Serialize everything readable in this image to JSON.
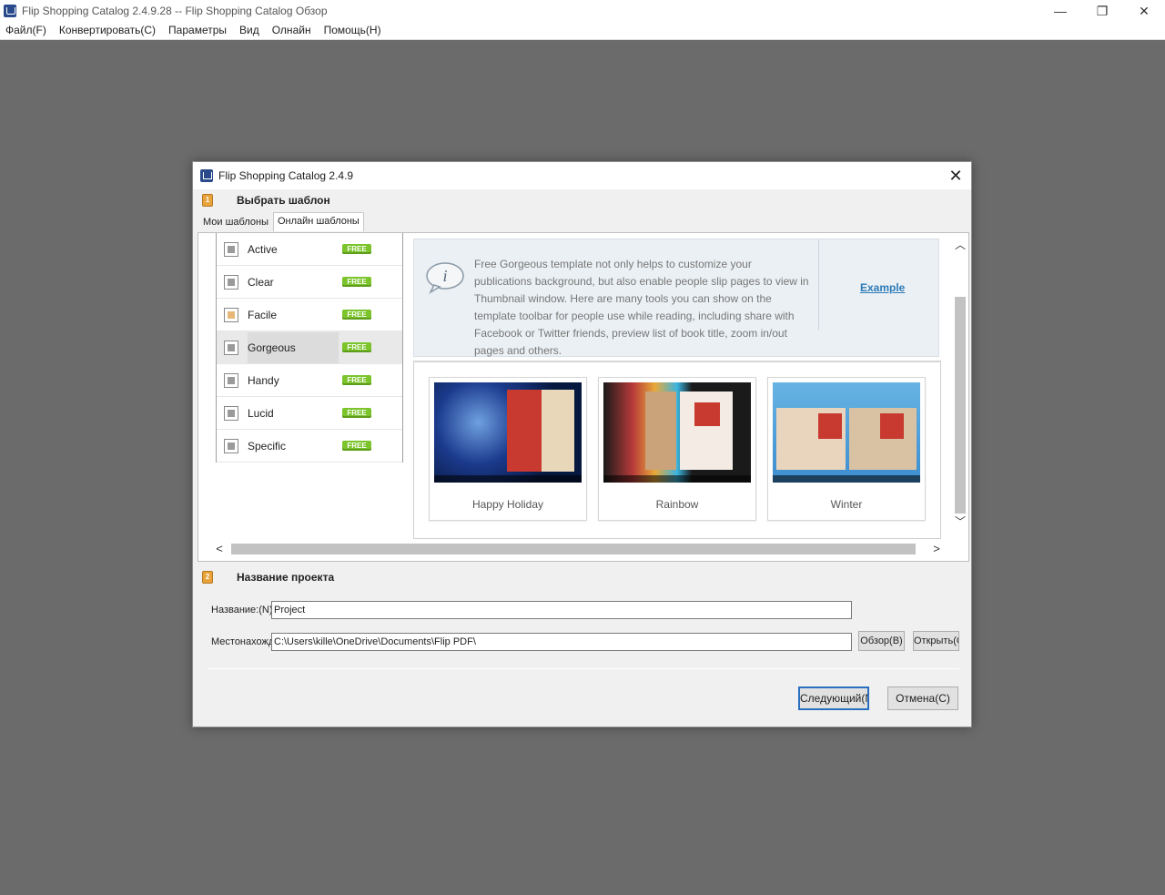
{
  "window": {
    "title": "Flip Shopping Catalog 2.4.9.28 -- Flip Shopping Catalog Обзор",
    "controls": {
      "minimize": "—",
      "maximize": "❐",
      "close": "✕"
    }
  },
  "menu": [
    "Файл(F)",
    "Конвертировать(C)",
    "Параметры",
    "Вид",
    "Олнайн",
    "Помощь(H)"
  ],
  "dialog": {
    "title": "Flip Shopping Catalog 2.4.9",
    "close": "✕",
    "step1": {
      "badge": "1",
      "label": "Выбрать шаблон"
    },
    "tabs": [
      {
        "label": "Мои шаблоны",
        "active": false
      },
      {
        "label": "Онлайн шаблоны",
        "active": true
      }
    ],
    "templates": [
      {
        "name": "Active",
        "badge": "FREE",
        "icon": "template-icon"
      },
      {
        "name": "Clear",
        "badge": "FREE",
        "icon": "template-icon"
      },
      {
        "name": "Facile",
        "badge": "FREE",
        "icon": "template-gold-icon"
      },
      {
        "name": "Gorgeous",
        "badge": "FREE",
        "icon": "template-icon",
        "selected": true
      },
      {
        "name": "Handy",
        "badge": "FREE",
        "icon": "template-icon"
      },
      {
        "name": "Lucid",
        "badge": "FREE",
        "icon": "template-icon"
      },
      {
        "name": "Specific",
        "badge": "FREE",
        "icon": "template-icon"
      }
    ],
    "info": {
      "icon": "info-bubble-icon",
      "text": "Free Gorgeous template not only helps to customize your publications background, but also enable people slip pages to view in Thumbnail window. Here are many tools you can show on the template toolbar for people use while reading, including share with Facebook or Twitter friends, preview list of book title, zoom in/out pages and others.",
      "example_link": "Example"
    },
    "themes": [
      {
        "name": "Happy Holiday"
      },
      {
        "name": "Rainbow"
      },
      {
        "name": "Winter"
      }
    ],
    "scroll": {
      "up": "︿",
      "down": "﹀",
      "left": "<",
      "right": ">"
    },
    "step2": {
      "badge": "2",
      "label": "Название проекта"
    },
    "form": {
      "name_label": "Название:(N)",
      "name_value": "Project",
      "location_label": "Местонахождение",
      "location_value": "C:\\Users\\kille\\OneDrive\\Documents\\Flip PDF\\",
      "browse_label": "Обзор(B)",
      "open_label": "Открыть(O)"
    },
    "buttons": {
      "next": "Следующий(N)",
      "cancel": "Отмена(C)"
    }
  },
  "colors": {
    "workspace": "#6b6b6b",
    "free_badge": "#7bc42b",
    "link": "#2a7ab8",
    "primary_border": "#2a6fc0"
  }
}
